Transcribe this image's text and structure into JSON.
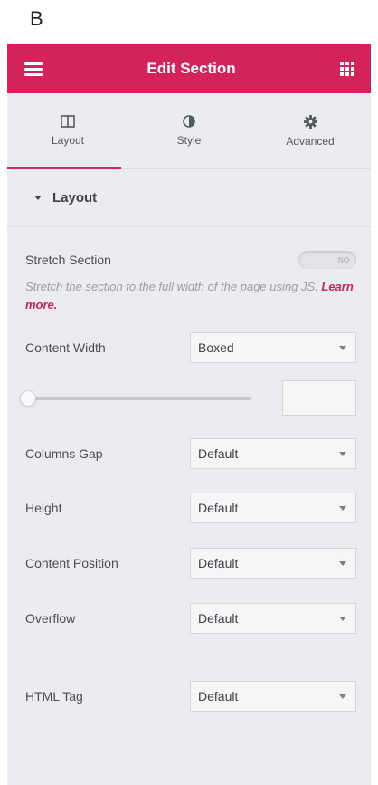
{
  "corner_label": "B",
  "header": {
    "title": "Edit Section"
  },
  "tabs": [
    {
      "label": "Layout",
      "icon": "columns-icon",
      "active": true
    },
    {
      "label": "Style",
      "icon": "half-circle-icon",
      "active": false
    },
    {
      "label": "Advanced",
      "icon": "gear-icon",
      "active": false
    }
  ],
  "section": {
    "title": "Layout",
    "stretch_section": {
      "label": "Stretch Section",
      "toggle_text": "NO",
      "description": "Stretch the section to the full width of the page using JS.",
      "link_text": "Learn more."
    },
    "content_width": {
      "label": "Content Width",
      "value": "Boxed"
    },
    "width_slider": {
      "value_fraction": 0,
      "input_value": ""
    },
    "columns_gap": {
      "label": "Columns Gap",
      "value": "Default"
    },
    "height": {
      "label": "Height",
      "value": "Default"
    },
    "content_position": {
      "label": "Content Position",
      "value": "Default"
    },
    "overflow": {
      "label": "Overflow",
      "value": "Default"
    },
    "html_tag": {
      "label": "HTML Tag",
      "value": "Default"
    }
  },
  "colors": {
    "accent": "#d4225a",
    "panel_bg": "#ebecef"
  }
}
